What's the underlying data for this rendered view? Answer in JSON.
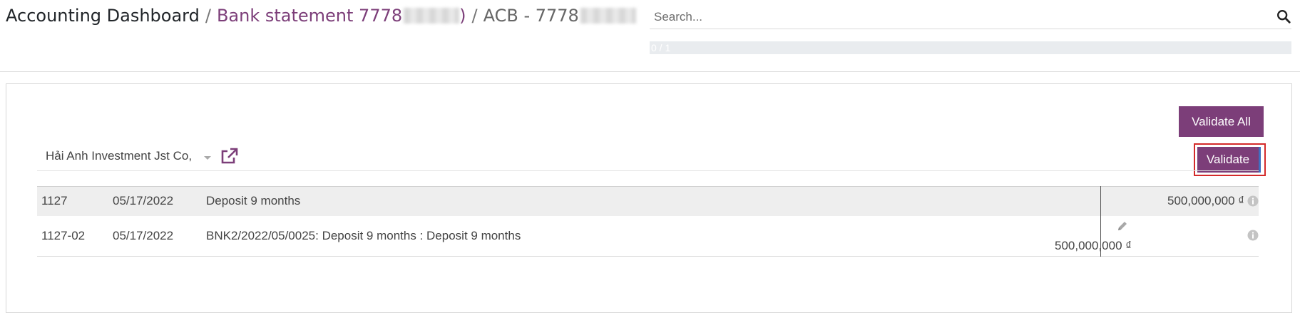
{
  "breadcrumb": {
    "root": "Accounting Dashboard",
    "separator": "/",
    "statement": "Bank statement 7778",
    "statement_tail": ")",
    "current": "ACB - 7778"
  },
  "search": {
    "placeholder": "Search..."
  },
  "progress": {
    "text": "0 / 1",
    "value": 0,
    "total": 1
  },
  "buttons": {
    "validate_all": "Validate All",
    "validate": "Validate"
  },
  "partner": {
    "name": "Hải Anh Investment Jst Co,"
  },
  "statement_line": {
    "ref": "1127",
    "date": "05/17/2022",
    "label": "Deposit 9 months",
    "amount": "500,000,000 ₫"
  },
  "move_line": {
    "ref": "1127-02",
    "date": "05/17/2022",
    "label": "BNK2/2022/05/0025: Deposit 9 months : Deposit 9 months",
    "amount": "500,000,000 ₫"
  },
  "colors": {
    "accent": "#7c3e79",
    "highlight_border": "#d42a2a"
  },
  "icons": [
    "search-icon",
    "caret-down-icon",
    "external-link-icon",
    "info-icon",
    "pencil-icon"
  ]
}
